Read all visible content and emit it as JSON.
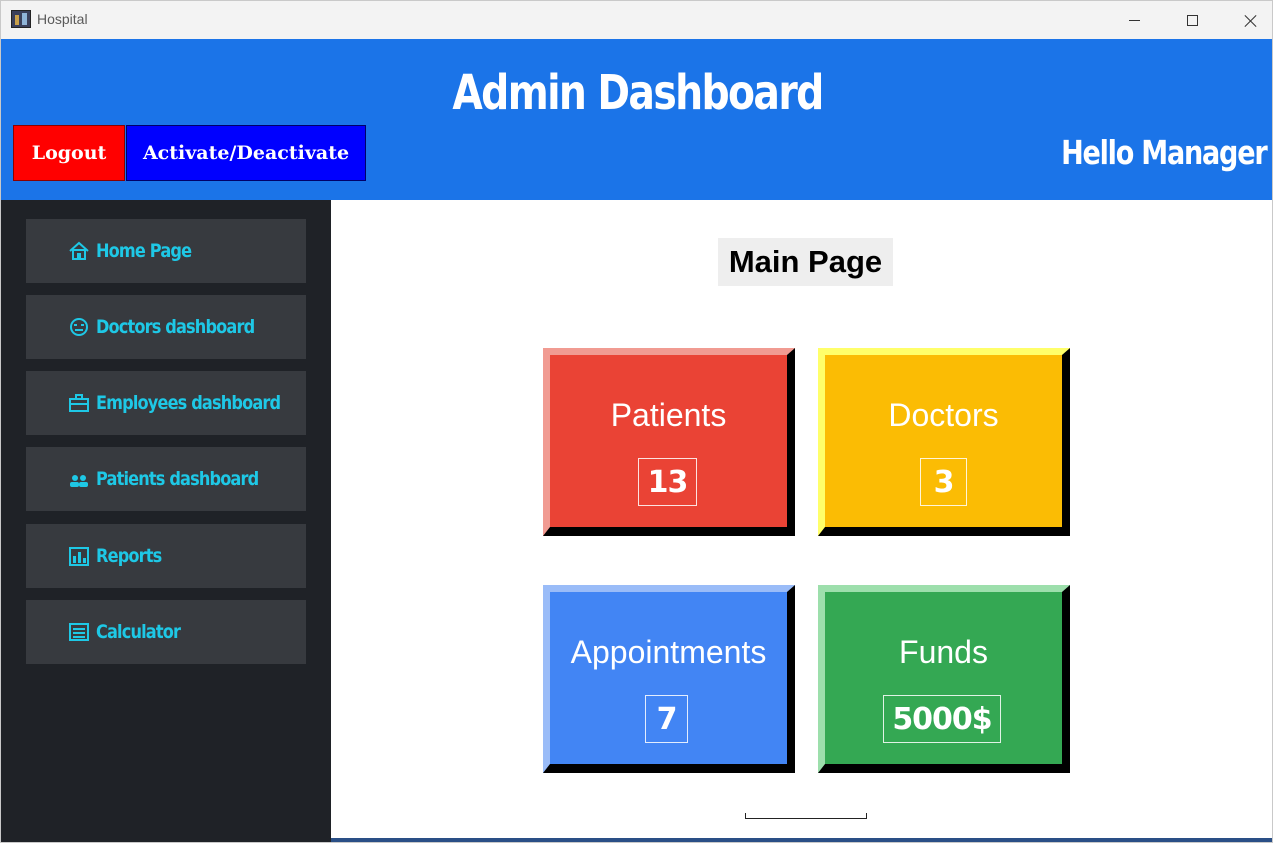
{
  "window": {
    "title": "Hospital",
    "controls": [
      "minimize",
      "maximize",
      "close"
    ]
  },
  "header": {
    "title": "Admin Dashboard",
    "greeting": "Hello Manager",
    "logout_label": "Logout",
    "activate_label": "Activate/Deactivate",
    "colors": {
      "background": "#1b74e8",
      "logout": "#ff0000",
      "activate": "#0000ff"
    }
  },
  "sidebar": {
    "items": [
      {
        "label": "Home Page",
        "icon": "home-icon"
      },
      {
        "label": "Doctors dashboard",
        "icon": "face-icon"
      },
      {
        "label": "Employees dashboard",
        "icon": "briefcase-icon"
      },
      {
        "label": "Patients dashboard",
        "icon": "users-icon"
      },
      {
        "label": "Reports",
        "icon": "bar-chart-icon"
      },
      {
        "label": "Calculator",
        "icon": "calculator-icon"
      }
    ],
    "colors": {
      "background": "#1f2227",
      "item": "#373a3f",
      "text": "#1ec8e6"
    }
  },
  "main": {
    "title": "Main Page",
    "cards": [
      {
        "label": "Patients",
        "value": "13",
        "color": "#ea4335"
      },
      {
        "label": "Doctors",
        "value": "3",
        "color": "#fbbc04"
      },
      {
        "label": "Appointments",
        "value": "7",
        "color": "#4285f4"
      },
      {
        "label": "Funds",
        "value": "5000$",
        "color": "#34a853"
      }
    ]
  }
}
